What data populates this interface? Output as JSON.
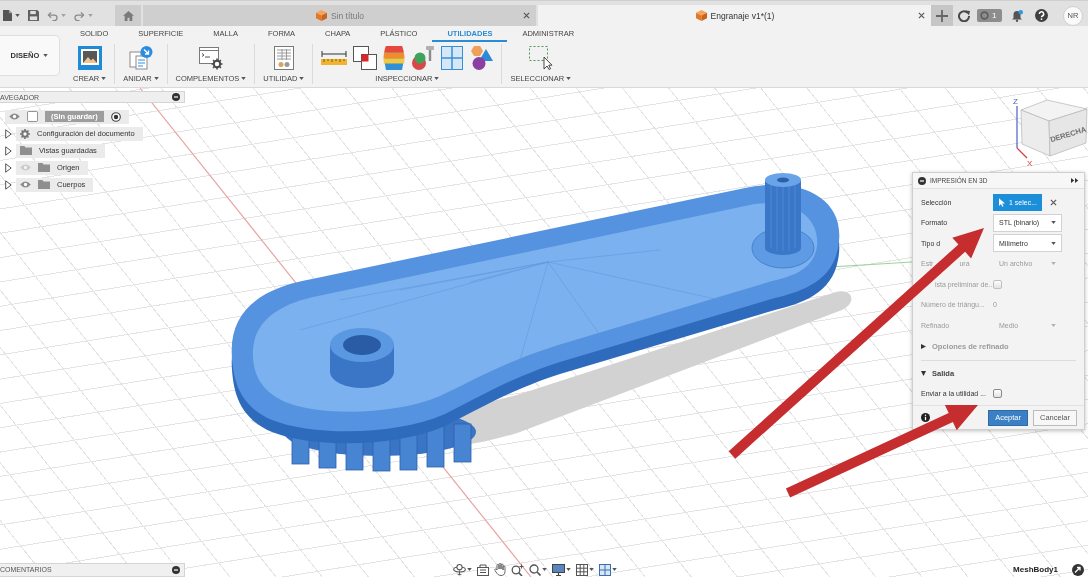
{
  "title_bar": {
    "tabs": [
      {
        "title": "Sin título",
        "selected": false
      },
      {
        "title": "Engranaje v1*(1)",
        "selected": true
      }
    ],
    "job_count": "1",
    "user_initials": "NR"
  },
  "ribbon": {
    "workspace": "DISEÑO",
    "tabs": [
      {
        "label": "SOLIDO",
        "selected": false
      },
      {
        "label": "SUPERFICIE",
        "selected": false
      },
      {
        "label": "MALLA",
        "selected": false
      },
      {
        "label": "FORMA",
        "selected": false
      },
      {
        "label": "CHAPA",
        "selected": false
      },
      {
        "label": "PLÁSTICO",
        "selected": false
      },
      {
        "label": "UTILIDADES",
        "selected": true
      },
      {
        "label": "ADMINISTRAR",
        "selected": false
      }
    ],
    "groups": [
      {
        "label": "CREAR",
        "tools": [
          {
            "kind": "image"
          }
        ]
      },
      {
        "label": "ANIDAR",
        "tools": [
          {
            "kind": "insert"
          }
        ]
      },
      {
        "label": "COMPLEMENTOS",
        "tools": [
          {
            "kind": "addins"
          }
        ]
      },
      {
        "label": "UTILIDAD",
        "tools": [
          {
            "kind": "spreadsheet"
          }
        ]
      },
      {
        "label": "INSPECCIONAR",
        "tools": [
          {
            "kind": "measure"
          },
          {
            "kind": "interference"
          },
          {
            "kind": "zebra"
          },
          {
            "kind": "draft"
          },
          {
            "kind": "section"
          },
          {
            "kind": "component_color"
          }
        ]
      },
      {
        "label": "SELECCIONAR",
        "tools": [
          {
            "kind": "select"
          }
        ]
      }
    ]
  },
  "browser": {
    "title": "AVEGADOR",
    "items": [
      {
        "kind": "root",
        "label": "(Sin guardar)",
        "visible": true,
        "active": true,
        "children": [
          {
            "kind": "settings",
            "label": "Configuración del documento",
            "expanded": false
          },
          {
            "kind": "folder",
            "label": "Vistas guardadas",
            "expanded": false
          },
          {
            "kind": "folder",
            "label": "Origen",
            "expanded": false,
            "visible": false
          },
          {
            "kind": "folder",
            "label": "Cuerpos",
            "expanded": false,
            "visible": true
          }
        ]
      }
    ]
  },
  "view_cube": {
    "face_label": "DERECHA",
    "axes": [
      {
        "kind": "z",
        "label": "Z"
      },
      {
        "kind": "x",
        "label": "X"
      }
    ]
  },
  "print_dialog": {
    "title": "IMPRESIÓN EN 3D",
    "rows": [
      {
        "kind": "selection",
        "label": "Selección",
        "value": "1 selec...",
        "disabled": false
      },
      {
        "kind": "dropdown",
        "label": "Formato",
        "value": "STL (binario)",
        "disabled": false
      },
      {
        "kind": "dropdown",
        "label": "Tipo d",
        "value": "Milímetro",
        "disabled": false
      },
      {
        "kind": "dropdown",
        "label": "Estr",
        "label_tail": "ura",
        "value": "Un archivo",
        "disabled": true
      },
      {
        "kind": "checkbox",
        "label": "ista preliminar de...",
        "checked": false,
        "disabled": true
      },
      {
        "kind": "value",
        "label": "Número de triángu...",
        "value": "0",
        "disabled": true
      },
      {
        "kind": "dropdown",
        "label": "Refinado",
        "value": "Medio",
        "disabled": true
      }
    ],
    "sections": [
      {
        "title": "Opciones de refinado",
        "expanded": false,
        "disabled": true
      },
      {
        "title": "Salida",
        "expanded": true,
        "disabled": false,
        "rows": [
          {
            "kind": "checkbox",
            "label": "Enviar a la utilidad ...",
            "checked": false,
            "disabled": false
          }
        ]
      }
    ],
    "buttons": [
      {
        "kind": "primary",
        "label": "Aceptar"
      },
      {
        "kind": "secondary",
        "label": "Cancelar"
      }
    ]
  },
  "comments_panel": {
    "title": "COMENTARIOS"
  },
  "nav_toolbar": {
    "tools": [
      {
        "kind": "orbit",
        "menu": true
      },
      {
        "kind": "look_at",
        "menu": false
      },
      {
        "kind": "pan",
        "menu": false
      },
      {
        "kind": "zoom",
        "menu": false
      },
      {
        "kind": "zoom_window",
        "menu": true
      },
      {
        "kind": "display",
        "menu": true
      },
      {
        "kind": "grid",
        "menu": true
      },
      {
        "kind": "viewports",
        "menu": true
      }
    ]
  },
  "status_bar": {
    "selection": "MeshBody1"
  },
  "annotations": [
    {
      "kind": "arrow"
    },
    {
      "kind": "arrow"
    }
  ]
}
